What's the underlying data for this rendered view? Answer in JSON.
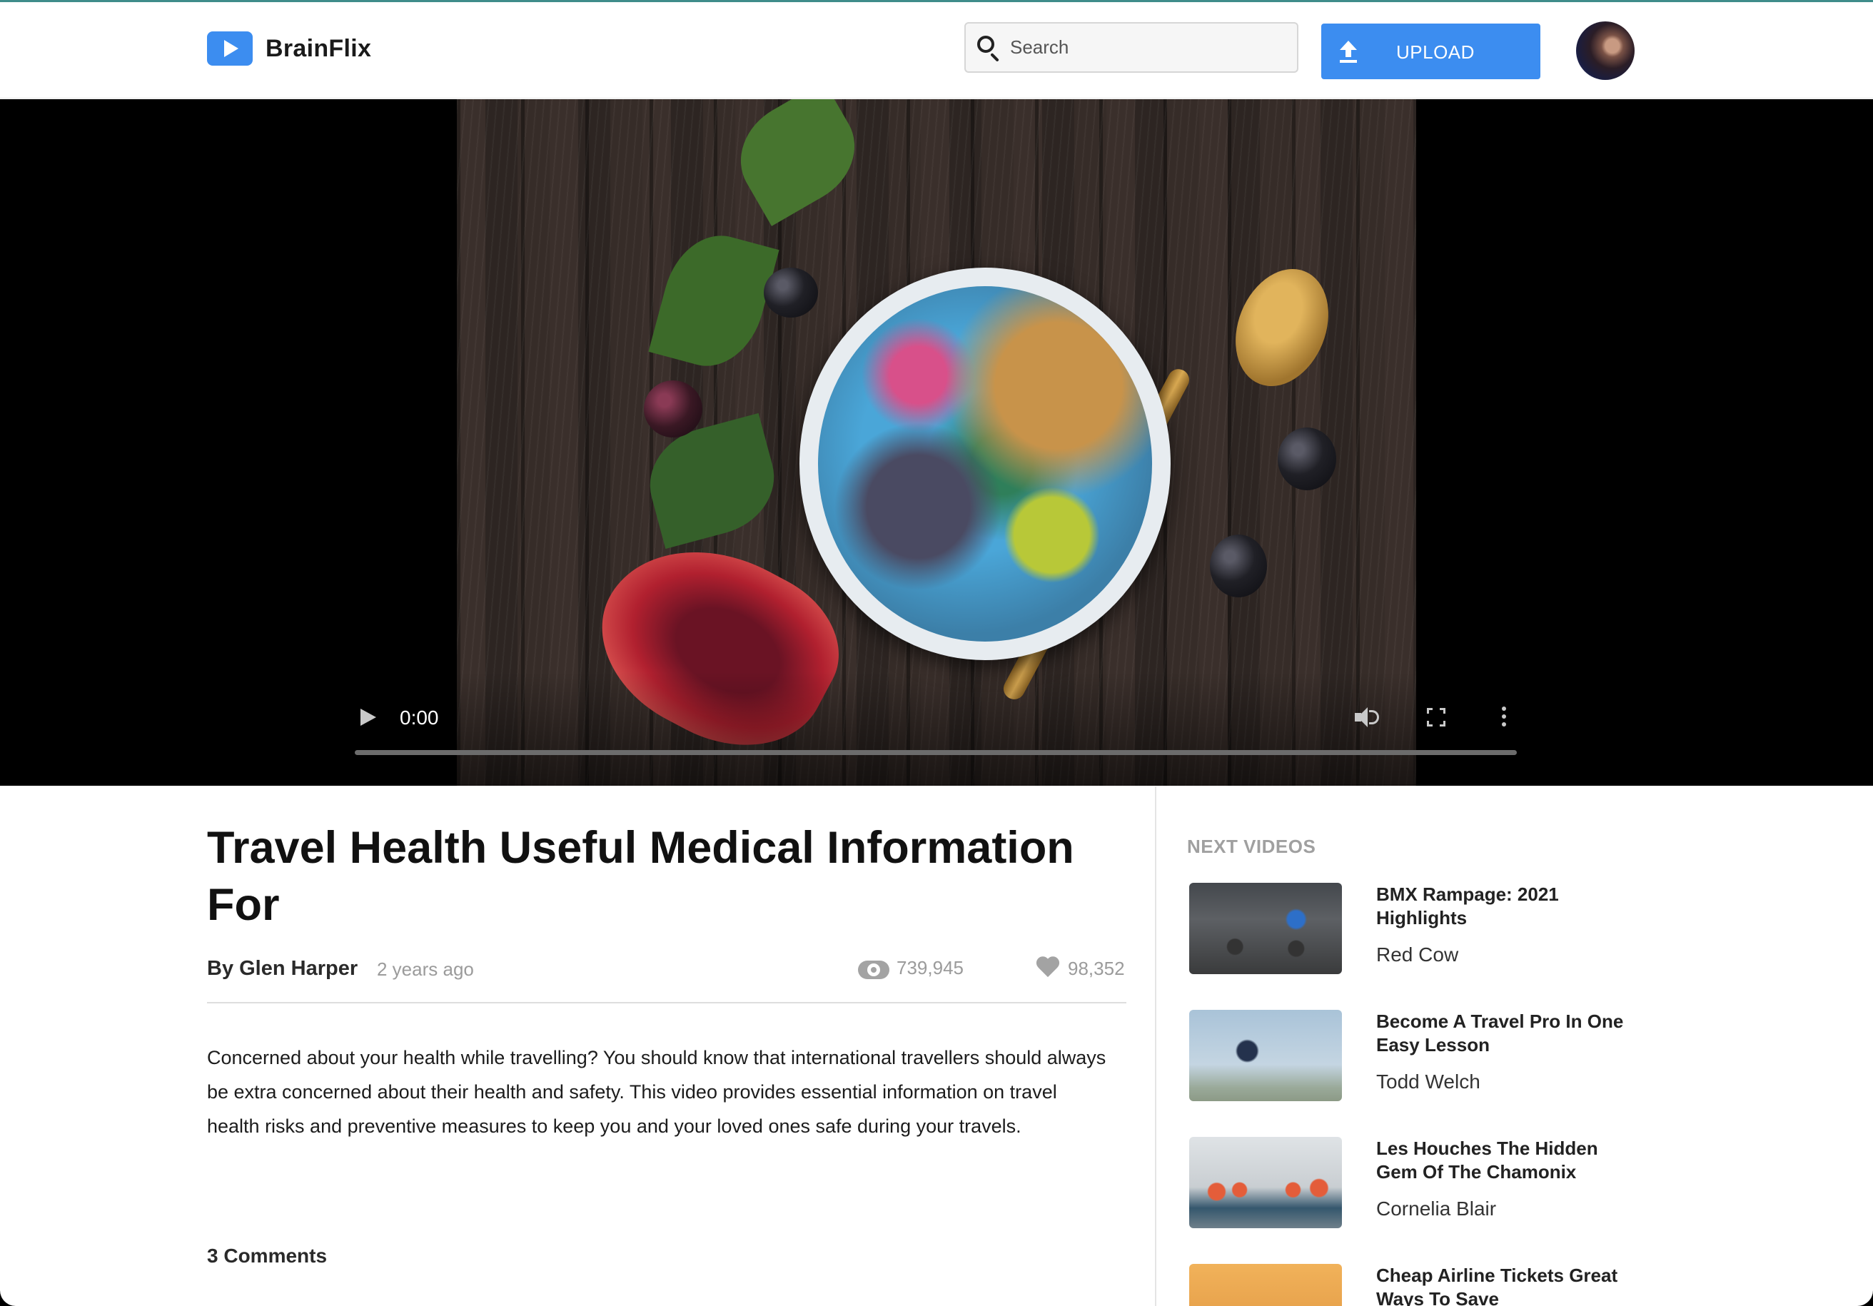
{
  "app": {
    "name": "BrainFlix"
  },
  "header": {
    "search_placeholder": "Search",
    "upload_label": "UPLOAD"
  },
  "player": {
    "current_time": "0:00",
    "progress": 0
  },
  "video": {
    "title": "Travel Health Useful Medical Information For",
    "author": "By Glen Harper",
    "posted": "2 years ago",
    "views": "739,945",
    "likes": "98,352",
    "description": "Concerned about your health while travelling? You should know that international travellers should always be extra concerned about their health and safety. This video provides essential information on travel health risks and preventive measures to keep you and your loved ones safe during your travels.",
    "comments_count": "3 Comments"
  },
  "sidebar": {
    "heading": "NEXT VIDEOS",
    "items": [
      {
        "title": "BMX Rampage: 2021 Highlights",
        "channel": "Red Cow"
      },
      {
        "title": "Become A Travel Pro In One Easy Lesson",
        "channel": "Todd Welch"
      },
      {
        "title": "Les Houches The Hidden Gem Of The Chamonix",
        "channel": "Cornelia Blair"
      },
      {
        "title": "Cheap Airline Tickets Great Ways To Save",
        "channel": ""
      }
    ]
  },
  "colors": {
    "accent": "#3c8df0",
    "muted_text": "#9b9b9b"
  },
  "icons": [
    "play-logo-icon",
    "search-icon",
    "upload-icon",
    "play-icon",
    "volume-icon",
    "fullscreen-icon",
    "more-options-icon",
    "eye-icon",
    "heart-icon"
  ]
}
